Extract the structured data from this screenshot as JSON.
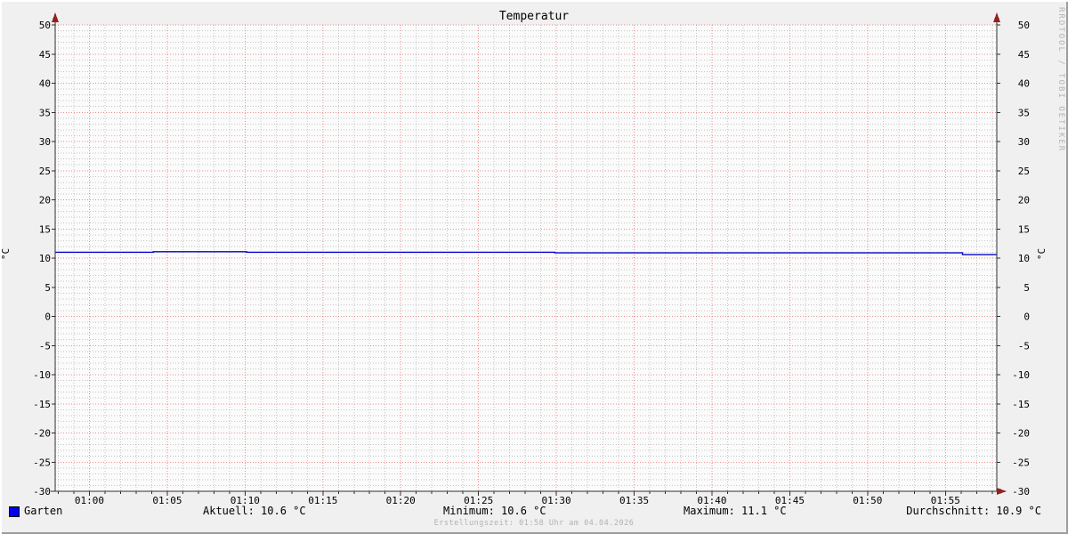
{
  "title": "Temperatur",
  "watermark": "RRDTOOL / TOBI OETIKER",
  "footer": "Erstellungszeit: 01:58 Uhr am 04.04.2026",
  "y_axis_unit_left": "°C",
  "y_axis_unit_right": "°C",
  "legend": {
    "series_label": "Garten",
    "swatch_color": "#0000f0",
    "stats": [
      {
        "name": "aktuell",
        "label": "Aktuell: 10.6 °C"
      },
      {
        "name": "minimum",
        "label": "Minimum: 10.6 °C"
      },
      {
        "name": "maximum",
        "label": "Maximum: 11.1 °C"
      },
      {
        "name": "durchschnitt",
        "label": "Durchschnitt: 10.9 °C"
      }
    ]
  },
  "chart_data": {
    "type": "line",
    "title": "Temperatur",
    "ylabel": "°C",
    "ylim": [
      -30,
      50
    ],
    "y_major_step": 5,
    "y_minor_step": 1,
    "y_ticks": [
      50,
      45,
      40,
      35,
      30,
      25,
      20,
      15,
      10,
      5,
      0,
      -5,
      -10,
      -15,
      -20,
      -25,
      -30
    ],
    "x_minutes_range": [
      -2.2,
      58.3
    ],
    "x_major_step_min": 5,
    "x_minor_step_min": 1,
    "x_tick_labels": [
      "01:00",
      "01:05",
      "01:10",
      "01:15",
      "01:20",
      "01:25",
      "01:30",
      "01:35",
      "01:40",
      "01:45",
      "01:50",
      "01:55"
    ],
    "grid_on": true,
    "legend_position": "bottom",
    "series": [
      {
        "name": "Garten",
        "color": "#0202d0",
        "points_min_degC": [
          [
            -2.2,
            11.0
          ],
          [
            4.1,
            11.0
          ],
          [
            4.1,
            11.1
          ],
          [
            10.1,
            11.1
          ],
          [
            10.1,
            11.0
          ],
          [
            29.9,
            11.0
          ],
          [
            29.9,
            10.9
          ],
          [
            56.1,
            10.9
          ],
          [
            56.1,
            10.6
          ],
          [
            58.3,
            10.6
          ]
        ]
      }
    ],
    "stats": {
      "aktuell": 10.6,
      "minimum": 10.6,
      "maximum": 11.1,
      "durchschnitt": 10.9
    },
    "style": {
      "background_color": "#f0f0f0",
      "canvas_color": "#fbfbfb",
      "grid_major_color": "#dd2222",
      "grid_minor_color": "#999999",
      "axis_color": "#2f2f2f",
      "arrow_color": "#991f1f",
      "tick_label_color": "#000000"
    }
  }
}
